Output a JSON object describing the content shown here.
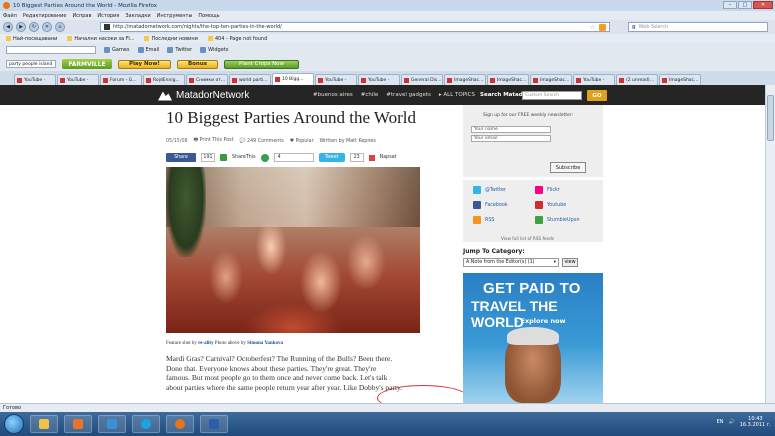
{
  "window": {
    "title": "10 Biggest Parties Around the World - Mozilla Firefox",
    "min": "–",
    "max": "□",
    "close": "✕"
  },
  "menu": [
    "Файл",
    "Редактирование",
    "Исправ",
    "История",
    "Закладки",
    "Инструменты",
    "Помощь"
  ],
  "nav": {
    "url": "http://matadornetwork.com/nights/the-top-ten-parties-in-the-world/",
    "search_placeholder": "Web Search"
  },
  "bookmarks": [
    "Най-посещавани",
    "Начални насоки за Fi...",
    "Последни новини",
    "404 - Page not found"
  ],
  "toolbar1": [
    "Games",
    "Email",
    "Twitter",
    "Widgets"
  ],
  "toolbar2": {
    "search_value": "party people island",
    "farmville": "FARMVILLE",
    "play": "Play Now!",
    "bonus": "Bonus",
    "plant": "Plant Crops Now"
  },
  "tabs": [
    "YouTube -",
    "YouTube -",
    "Forum - G...",
    "RojdEnnig...",
    "Снимки от...",
    "world parti...",
    "10 Bigg...",
    "YouTube -",
    "YouTube -",
    "General Dis...",
    "ImageShac...",
    "ImageShac...",
    "ImageShac...",
    "YouTube -",
    "(2 unread)...",
    "ImageShac..."
  ],
  "matador": {
    "logo": "MatadorNetwork",
    "links": [
      "#buenos aires",
      "#chile",
      "#travel gadgets",
      "▸ ALL TOPICS"
    ],
    "search_label": "Search Matador",
    "search_placeholder": "Custom Search",
    "go": "GO"
  },
  "article": {
    "title": "10 Biggest Parties Around the World",
    "date": "05/15/08",
    "print": "Print This Post",
    "comments": "249 Comments",
    "popular": "Popular",
    "writer": "Written by Matt Kepnes",
    "share_label": "Share",
    "share_count": "191",
    "sharethis": "ShareThis",
    "buzz_count": "4",
    "tweet": "Tweet",
    "tweet_count": "23",
    "napsat": "Napsat",
    "caption_prefix": "Feature shot by ",
    "caption_user": "re-ality",
    "caption_mid": " Photo above by ",
    "caption_author": "Simona Yankova",
    "body_lines": [
      "Mardi Gras? Carnival? Octoberfest? The Running of the Bulls? Been there.",
      "Done that. Everyone knows about these parties. They're great. They're",
      "famous. But most people go to them once and never come back. Let's talk",
      "about parties where the same people return year after year. Like Dobby's party."
    ]
  },
  "sidebar": {
    "newsletter_title": "Sign up for our FREE weekly newsletter:",
    "name_placeholder": "Your name",
    "email_placeholder": "Your email",
    "subscribe": "Subscribe",
    "social": {
      "twitter": "@Twitter",
      "flickr": "Flickr",
      "facebook": "Facebook",
      "youtube": "Youtube",
      "rss": "RSS",
      "stumbleupon": "StumbleUpon",
      "full_list": "View full list of RSS feeds"
    },
    "jump_title": "Jump To Category:",
    "jump_selected": "A Note from the Editor(s)  (1)",
    "view": "view",
    "ad": {
      "line1": "GET PAID TO",
      "line2": "TRAVEL THE WORLD",
      "explore": "▸ Explore now"
    }
  },
  "status": "Готово",
  "tray": {
    "lang": "EN",
    "time": "10:43",
    "date": "16.3.2011 г."
  }
}
